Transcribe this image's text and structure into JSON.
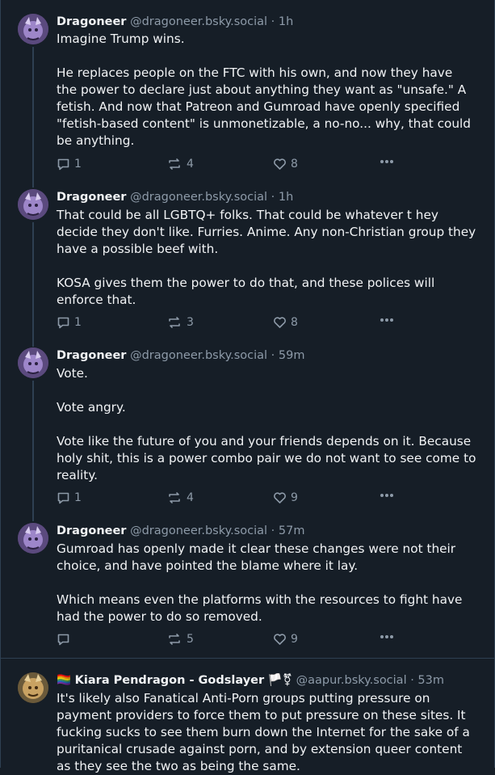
{
  "posts": [
    {
      "name": "Dragoneer",
      "handle": "@dragoneer.bsky.social · 1h",
      "paragraphs": [
        "Imagine Trump wins.",
        "He replaces people on the FTC with his own, and now they have the power to declare just about anything they want as \"unsafe.\" A fetish. And now that Patreon and Gumroad have openly specified \"fetish-based content\" is unmonetizable, a no-no... why, that could be anything."
      ],
      "replies": "1",
      "reposts": "4",
      "likes": "8"
    },
    {
      "name": "Dragoneer",
      "handle": "@dragoneer.bsky.social · 1h",
      "paragraphs": [
        "That could be all LGBTQ+ folks. That could be whatever t hey decide they don't like. Furries. Anime. Any non-Christian group they have a possible beef with.",
        "KOSA gives them the power to do that, and these polices will enforce that."
      ],
      "replies": "1",
      "reposts": "3",
      "likes": "8"
    },
    {
      "name": "Dragoneer",
      "handle": "@dragoneer.bsky.social · 59m",
      "paragraphs": [
        "Vote.",
        "Vote angry.",
        "Vote like the future of you and your friends depends on it. Because holy shit, this is a power combo pair we do not want to see come to reality."
      ],
      "replies": "1",
      "reposts": "4",
      "likes": "9"
    },
    {
      "name": "Dragoneer",
      "handle": "@dragoneer.bsky.social · 57m",
      "paragraphs": [
        "Gumroad has openly made it clear these changes were not their choice, and have pointed the blame where it lay.",
        "Which means even the platforms with the resources to fight have had the power to do so removed."
      ],
      "replies": "",
      "reposts": "5",
      "likes": "9"
    },
    {
      "name": "Kiara Pendragon - Godslayer",
      "name_prefix": "🏳️‍🌈",
      "name_suffix": "🏳️⚧",
      "handle": "@aapur.bsky.social · 53m",
      "paragraphs": [
        "It's likely also Fanatical Anti-Porn groups putting pressure on payment providers to force them to put pressure on these sites. It fucking sucks to see them burn down the Internet for the sake of a puritanical crusade against porn, and by extension queer content as they see the two as being the same."
      ]
    }
  ],
  "icons": {
    "reply": "speech-bubble-icon",
    "repost": "repost-arrows-icon",
    "like": "heart-icon",
    "more": "ellipsis-icon"
  },
  "colors": {
    "background": "#161e27",
    "text": "#f1f3f5",
    "muted": "#8d9aa8",
    "border": "#2e4052"
  }
}
